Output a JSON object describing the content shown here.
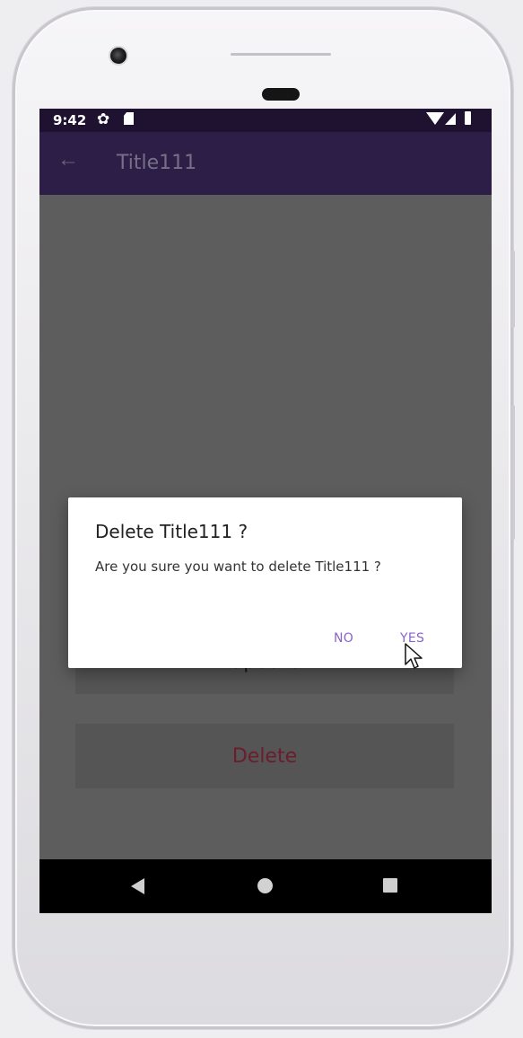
{
  "status_bar": {
    "time": "9:42",
    "icons": [
      "gear-icon",
      "sd-card-icon",
      "wifi-icon",
      "signal-icon",
      "battery-icon"
    ]
  },
  "app_bar": {
    "back_icon": "back-arrow-icon",
    "title": "Title111",
    "color": "#2d1e48"
  },
  "dialog": {
    "title": "Delete Title111 ?",
    "message": "Are you sure you want to delete Title111 ?",
    "no_label": "NO",
    "yes_label": "YES",
    "accent_color": "#8a63cc"
  },
  "buttons": {
    "update_label": "Update",
    "delete_label": "Delete"
  },
  "nav_bar": {
    "icons": [
      "nav-back-icon",
      "nav-home-icon",
      "nav-recents-icon"
    ]
  }
}
